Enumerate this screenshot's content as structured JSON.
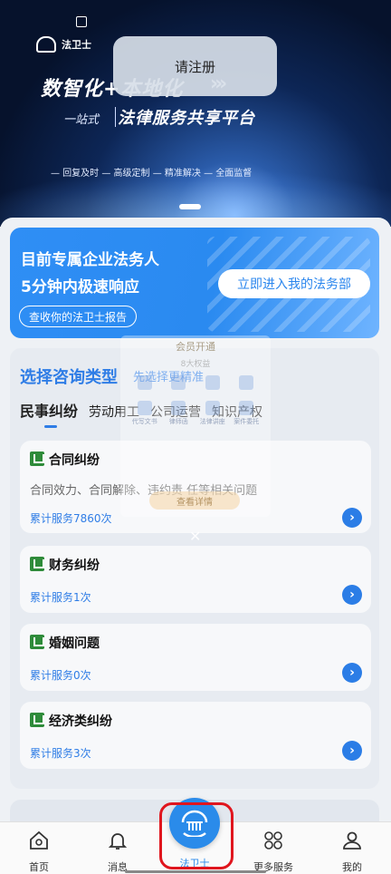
{
  "toast": {
    "text": "请注册"
  },
  "hero": {
    "brand_name": "法卫士",
    "headline": "数智化+本地化",
    "sub_left": "一站式",
    "sub_main": "法律服务共享平台",
    "features": "— 回复及时 — 高级定制 — 精准解决 — 全面监督"
  },
  "promo": {
    "line1": "目前专属企业法务人",
    "line2": "5分钟内极速响应",
    "report_button": "查收你的法卫士报告",
    "enter_button": "立即进入我的法务部"
  },
  "consult": {
    "title": "选择咨询类型",
    "hint": "先选择更精准",
    "tabs": [
      "民事纠纷",
      "劳动用工",
      "公司运营",
      "知识产权"
    ],
    "active_tab": "民事纠纷",
    "cards": [
      {
        "name": "合同纠纷",
        "desc": "合同效力、合同解除、违约责 任等相关问题",
        "count": "累计服务7860次"
      },
      {
        "name": "财务纠纷",
        "desc": "",
        "count": "累计服务1次"
      },
      {
        "name": "婚姻问题",
        "desc": "",
        "count": "累计服务0次"
      },
      {
        "name": "经济类纠纷",
        "desc": "",
        "count": "累计服务3次"
      }
    ]
  },
  "popup": {
    "title": "会员开通",
    "subtitle": "8大权益",
    "items": [
      "",
      "",
      "",
      "",
      "代写文书",
      "律师函",
      "法律讲座",
      "案件委托"
    ],
    "button": "查看详情",
    "close": "✕"
  },
  "nav": {
    "items": [
      {
        "label": "首页",
        "icon": "home-icon"
      },
      {
        "label": "消息",
        "icon": "bell-icon"
      },
      {
        "label": "法卫士",
        "icon": "court-icon"
      },
      {
        "label": "更多服务",
        "icon": "grid-icon"
      },
      {
        "label": "我的",
        "icon": "user-icon"
      }
    ],
    "highlight_color": "#e0161e",
    "accent": "#2a8bea"
  }
}
